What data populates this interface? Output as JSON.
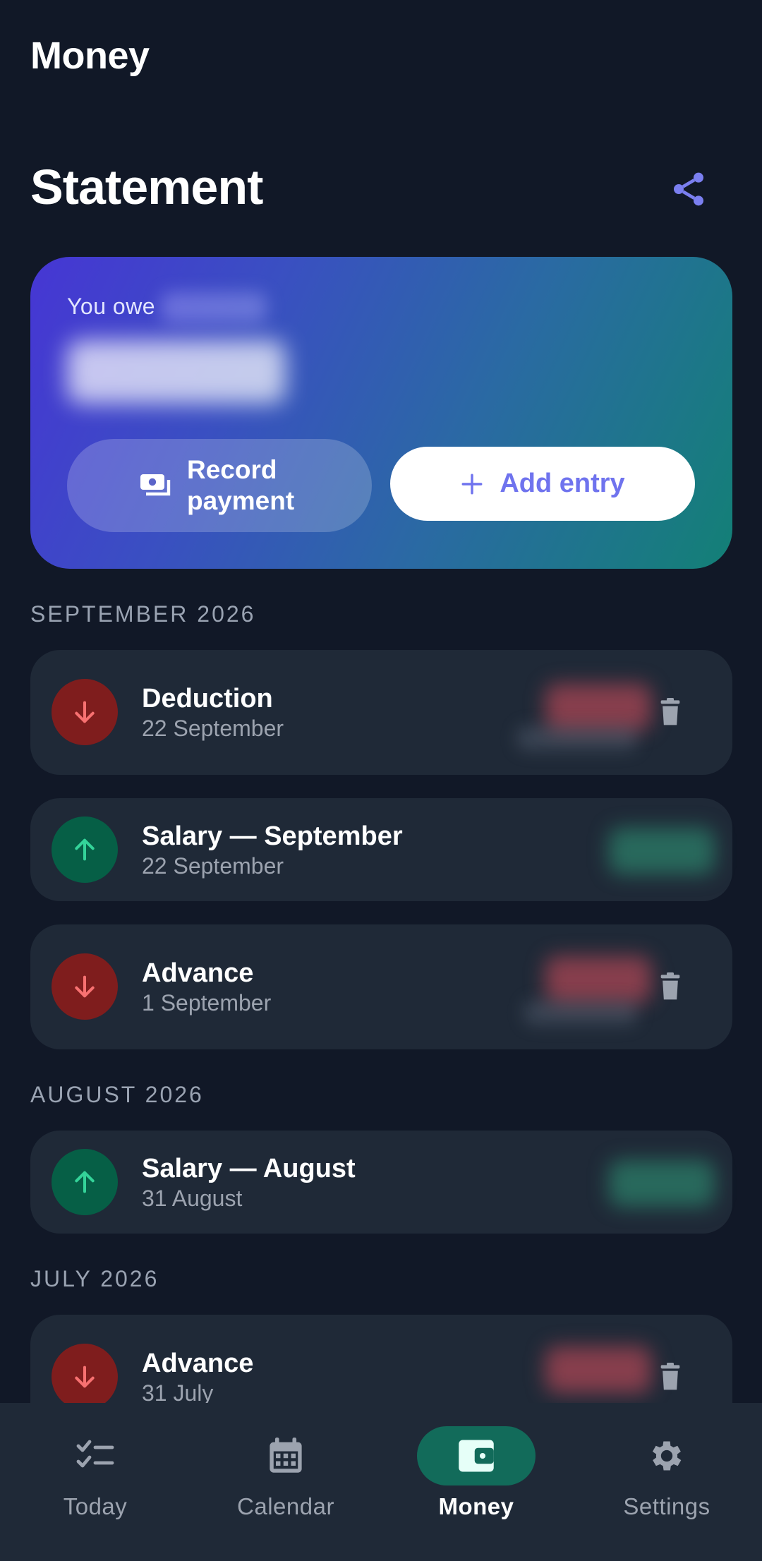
{
  "app": {
    "title": "Money"
  },
  "statement": {
    "title": "Statement",
    "share_icon": "share-icon"
  },
  "balance": {
    "label": "You owe",
    "record_label": "Record payment",
    "record_icon": "payments-icon",
    "add_label": "Add entry",
    "add_icon": "plus-icon",
    "gradient": [
      "#4636d4",
      "#138076"
    ]
  },
  "months": [
    {
      "header": "SEPTEMBER 2026",
      "entries": [
        {
          "title": "Deduction",
          "date": "22 September",
          "direction": "down",
          "deletable": true
        },
        {
          "title": "Salary — September",
          "date": "22 September",
          "direction": "up",
          "deletable": false
        },
        {
          "title": "Advance",
          "date": "1 September",
          "direction": "down",
          "deletable": true
        }
      ]
    },
    {
      "header": "AUGUST 2026",
      "entries": [
        {
          "title": "Salary — August",
          "date": "31 August",
          "direction": "up",
          "deletable": false
        }
      ]
    },
    {
      "header": "JULY 2026",
      "entries": [
        {
          "title": "Advance",
          "date": "31 July",
          "direction": "down",
          "deletable": true
        }
      ]
    }
  ],
  "nav": {
    "items": [
      {
        "label": "Today",
        "icon": "checklist-icon",
        "active": false
      },
      {
        "label": "Calendar",
        "icon": "calendar-icon",
        "active": false
      },
      {
        "label": "Money",
        "icon": "wallet-icon",
        "active": true
      },
      {
        "label": "Settings",
        "icon": "gear-icon",
        "active": false
      }
    ]
  },
  "colors": {
    "background": "#111827",
    "card": "#1f2937",
    "accent": "#6f73ee",
    "debit": "#7f1d1d",
    "debit_arrow": "#f87171",
    "credit": "#065f46",
    "credit_arrow": "#34d399",
    "nav_active": "#126b5a"
  }
}
